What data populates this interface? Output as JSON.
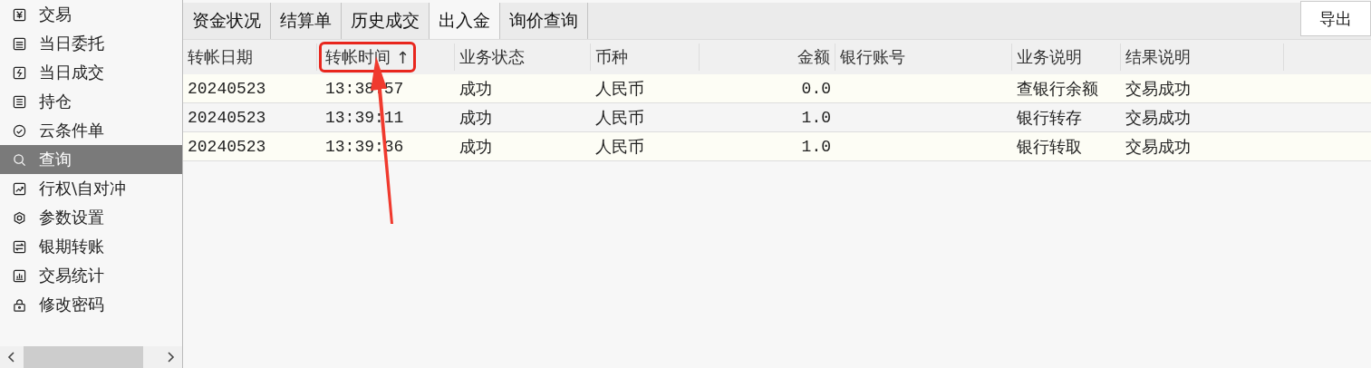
{
  "sidebar": {
    "items": [
      {
        "label": "交易",
        "selected": false
      },
      {
        "label": "当日委托",
        "selected": false
      },
      {
        "label": "当日成交",
        "selected": false
      },
      {
        "label": "持仓",
        "selected": false
      },
      {
        "label": "云条件单",
        "selected": false
      },
      {
        "label": "查询",
        "selected": true
      },
      {
        "label": "行权\\自对冲",
        "selected": false
      },
      {
        "label": "参数设置",
        "selected": false
      },
      {
        "label": "银期转账",
        "selected": false
      },
      {
        "label": "交易统计",
        "selected": false
      },
      {
        "label": "修改密码",
        "selected": false
      }
    ]
  },
  "tabs": [
    {
      "label": "资金状况",
      "selected": false
    },
    {
      "label": "结算单",
      "selected": false
    },
    {
      "label": "历史成交",
      "selected": false
    },
    {
      "label": "出入金",
      "selected": true
    },
    {
      "label": "询价查询",
      "selected": false
    }
  ],
  "export_button": "导出",
  "table": {
    "columns": [
      {
        "label": "转帐日期",
        "kind": "text",
        "highlighted": false
      },
      {
        "label": "转帐时间",
        "kind": "text",
        "sort_mark": "↑",
        "highlighted": true
      },
      {
        "label": "业务状态",
        "kind": "text",
        "highlighted": false
      },
      {
        "label": "币种",
        "kind": "text",
        "highlighted": false
      },
      {
        "label": "金额",
        "kind": "number",
        "highlighted": false
      },
      {
        "label": "银行账号",
        "kind": "text",
        "highlighted": false
      },
      {
        "label": "业务说明",
        "kind": "text",
        "highlighted": false
      },
      {
        "label": "结果说明",
        "kind": "text",
        "highlighted": false
      }
    ],
    "rows": [
      [
        "20240523",
        "13:38:57",
        "成功",
        "人民币",
        "0.0",
        "",
        "查银行余额",
        "交易成功"
      ],
      [
        "20240523",
        "13:39:11",
        "成功",
        "人民币",
        "1.0",
        "",
        "银行转存",
        "交易成功"
      ],
      [
        "20240523",
        "13:39:36",
        "成功",
        "人民币",
        "1.0",
        "",
        "银行转取",
        "交易成功"
      ]
    ]
  }
}
